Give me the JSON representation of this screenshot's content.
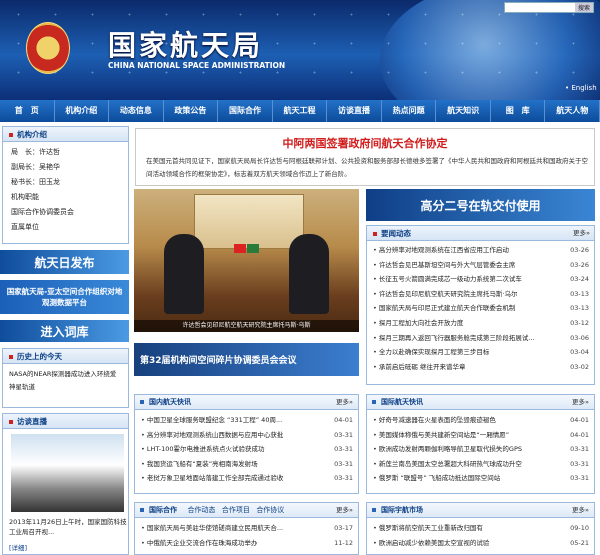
{
  "header": {
    "title_cn": "国家航天局",
    "title_en": "CHINA NATIONAL SPACE ADMINISTRATION",
    "english_link": "• English",
    "search_button": "搜索"
  },
  "nav": [
    "首　页",
    "机构介绍",
    "动态信息",
    "政策公告",
    "国际合作",
    "航天工程",
    "访谈直播",
    "热点问题",
    "航天知识",
    "图　库",
    "航天人物"
  ],
  "org": {
    "title": "机构介绍",
    "items": [
      "局　长：许达哲",
      "副局长：吴艳华",
      "秘书长：田玉龙",
      "机构职能",
      "国际合作协调委员会",
      "直属单位"
    ]
  },
  "banners": {
    "daily": "航天日发布",
    "platform": "国家航天局-亚太空间合作组织对地观测数据平台",
    "entry": "进入词库"
  },
  "history": {
    "title": "历史上的今天",
    "text": "NASA的NEAR探测器成功进入环绕爱神星轨道"
  },
  "interview": {
    "title": "访谈直播",
    "caption": "2013年11月26日上午时，国家国防科技工业局召开视...",
    "more": "[详细]"
  },
  "headline": {
    "title": "中阿两国签署政府间航天合作协定",
    "text": "在美国元首共同见证下，国家航天局局长许达哲与阿根廷联邦计划、公共投资和服务部部长德维多签署了《中华人民共和国政府和阿根廷共和国政府关于空间活动领域合作的框架协定》，标志着双方航天领域合作迈上了新台阶。"
  },
  "photo_caption": "许达哲会见印尼航空航天研究院主席托马斯·乌斯",
  "conference": "第32届机构间空间碎片协调委员会会议",
  "gaofen": "高分二号在轨交付使用",
  "important": {
    "title": "要闻动态",
    "more": "更多»",
    "items": [
      {
        "t": "高分辨率对地观测系统在江西省应用工作启动",
        "d": "03-26"
      },
      {
        "t": "许达哲会见巴基斯坦空间与外大气层管委会主席",
        "d": "03-26"
      },
      {
        "t": "长征五号火箭圆满完成芯一级动力系统第二次试车",
        "d": "03-24"
      },
      {
        "t": "许达哲会见印尼航空航天研究院主席托马斯·乌尔",
        "d": "03-13"
      },
      {
        "t": "国家航天局与印尼正式建立航天合作联委会机制",
        "d": "03-13"
      },
      {
        "t": "探月工程加大向社会开放力度",
        "d": "03-12"
      },
      {
        "t": "探月三期再入返回飞行器服务舱完成第三阶段拓展试...",
        "d": "03-06"
      },
      {
        "t": "全力以赴确保实现探月工程第三步目标",
        "d": "03-04"
      },
      {
        "t": "承前启后砥砺 继往开来谱华章",
        "d": "03-02"
      }
    ]
  },
  "domestic": {
    "title": "国内航天快讯",
    "more": "更多»",
    "items": [
      {
        "t": "中国卫星全球服务联盟纪念 “331工程” 40周...",
        "d": "04-01"
      },
      {
        "t": "高分辨率对地观测系统山西数据与应用中心获批",
        "d": "03-31"
      },
      {
        "t": "LHT-100霍尔电推进系统点火试验获成功",
        "d": "03-31"
      },
      {
        "t": "我国货运飞船有“夏装”亮相南海发射场",
        "d": "03-31"
      },
      {
        "t": "老挝万象卫星地面站落建工作全部完成通过验收",
        "d": "03-31"
      }
    ]
  },
  "international": {
    "title": "国际航天快讯",
    "more": "更多»",
    "items": [
      {
        "t": "好奇号减速器在火星表面的坠毁痕迹褪色",
        "d": "04-01"
      },
      {
        "t": "美国媒体称俄与美共建新空间站是“一厢情愿”",
        "d": "04-01"
      },
      {
        "t": "欧洲成功发射两颗伽利略导航卫星取代损失的GPS",
        "d": "03-31"
      },
      {
        "t": "新莲兰南岛美国太空总署超大科研热气球成功升空",
        "d": "03-31"
      },
      {
        "t": "俄罗斯 “联盟号” 飞船成功抵达国际空间站",
        "d": "03-31"
      }
    ]
  },
  "coop": {
    "title": "国际合作",
    "tabs": [
      "合作动态",
      "合作项目",
      "合作协议"
    ],
    "more": "更多»",
    "items": [
      {
        "t": "国家航天局与美驻华使馆磋商建立民用航天合...",
        "d": "03-17"
      },
      {
        "t": "中俄航天企业交流合作在珠海成功举办",
        "d": "11-12"
      }
    ]
  },
  "industry": {
    "title": "国际宇航市场",
    "more": "更多»",
    "items": [
      {
        "t": "俄罗斯将航空航天工业重新改归国有",
        "d": "09-10"
      },
      {
        "t": "欧洲启动减少依赖美国太空宣视的试验",
        "d": "05-21"
      }
    ]
  }
}
